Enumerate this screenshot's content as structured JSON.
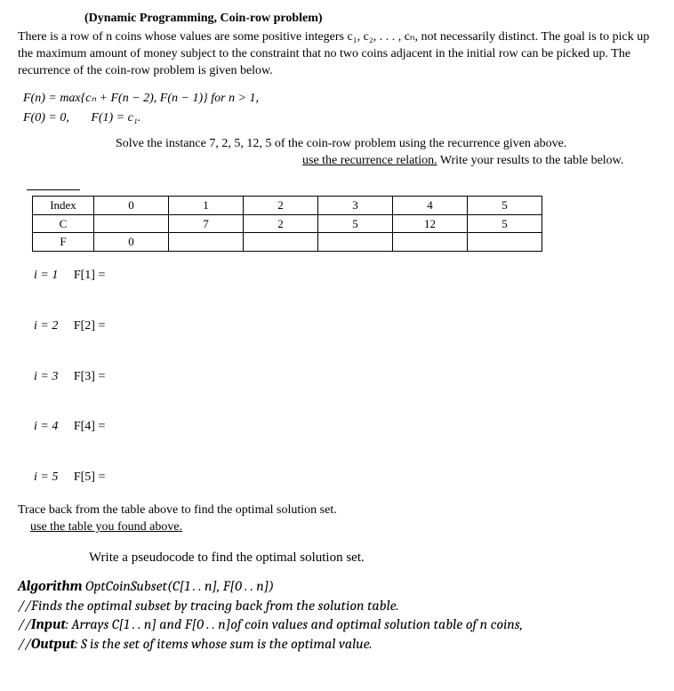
{
  "title": "(Dynamic Programming, Coin-row problem)",
  "para1": "There is a row of n coins whose values are some positive integers c₁, c₂, . . . , cₙ, not necessarily distinct. The goal is to pick up the maximum amount of money subject to the constraint that no two coins adjacent in the initial row can be picked up. The recurrence of the coin-row problem is given below.",
  "formula1": "F(n) = max{cₙ + F(n − 2),  F(n − 1)}    for n > 1,",
  "formula2a": "F(0) = 0,",
  "formula2b": "F(1) = c₁.",
  "solve1": "Solve the instance 7, 2, 5, 12, 5 of the coin-row problem using the recurrence given above.",
  "solve2a": "use the recurrence relation.",
  "solve2b": "  Write your results to the table below.",
  "table": {
    "row_labels": [
      "Index",
      "C",
      "F"
    ],
    "cols": [
      "0",
      "1",
      "2",
      "3",
      "4",
      "5"
    ],
    "c_row": [
      "",
      "7",
      "2",
      "5",
      "12",
      "5"
    ],
    "f_row": [
      "0",
      "",
      "",
      "",
      "",
      ""
    ]
  },
  "iters": [
    {
      "idx": "i = 1",
      "f": "F[1]  ="
    },
    {
      "idx": "i = 2",
      "f": "F[2]  ="
    },
    {
      "idx": "i = 3",
      "f": "F[3]  ="
    },
    {
      "idx": "i = 4",
      "f": "F[4]  ="
    },
    {
      "idx": "i = 5",
      "f": "F[5]  ="
    }
  ],
  "trace1": "Trace back from the table above to find the optimal solution set.",
  "trace2": "use the table you found above.",
  "pseudo_head": "Write a pseudocode to find the optimal solution set.",
  "algo": {
    "l1a": "Algorithm",
    "l1b": " OptCoinSubset(C[1 . . n],  F[0 . . n])",
    "l2": "//Finds the optimal subset by tracing back from the solution table.",
    "l3a": "//",
    "l3b": "Input",
    "l3c": ": Arrays C[1 . . n] and F[0 . . n]of coin values and optimal solution table of n coins,",
    "l4a": "//",
    "l4b": "Output",
    "l4c": ": S is the set of items whose sum is the optimal value."
  }
}
